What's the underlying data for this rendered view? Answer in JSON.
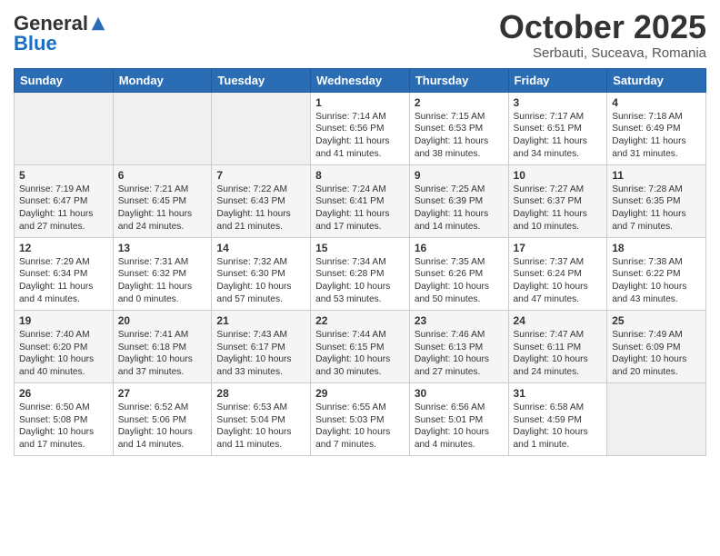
{
  "header": {
    "logo_general": "General",
    "logo_blue": "Blue",
    "month": "October 2025",
    "location": "Serbauti, Suceava, Romania"
  },
  "days_of_week": [
    "Sunday",
    "Monday",
    "Tuesday",
    "Wednesday",
    "Thursday",
    "Friday",
    "Saturday"
  ],
  "weeks": [
    [
      {
        "day": "",
        "content": ""
      },
      {
        "day": "",
        "content": ""
      },
      {
        "day": "",
        "content": ""
      },
      {
        "day": "1",
        "content": "Sunrise: 7:14 AM\nSunset: 6:56 PM\nDaylight: 11 hours and 41 minutes."
      },
      {
        "day": "2",
        "content": "Sunrise: 7:15 AM\nSunset: 6:53 PM\nDaylight: 11 hours and 38 minutes."
      },
      {
        "day": "3",
        "content": "Sunrise: 7:17 AM\nSunset: 6:51 PM\nDaylight: 11 hours and 34 minutes."
      },
      {
        "day": "4",
        "content": "Sunrise: 7:18 AM\nSunset: 6:49 PM\nDaylight: 11 hours and 31 minutes."
      }
    ],
    [
      {
        "day": "5",
        "content": "Sunrise: 7:19 AM\nSunset: 6:47 PM\nDaylight: 11 hours and 27 minutes."
      },
      {
        "day": "6",
        "content": "Sunrise: 7:21 AM\nSunset: 6:45 PM\nDaylight: 11 hours and 24 minutes."
      },
      {
        "day": "7",
        "content": "Sunrise: 7:22 AM\nSunset: 6:43 PM\nDaylight: 11 hours and 21 minutes."
      },
      {
        "day": "8",
        "content": "Sunrise: 7:24 AM\nSunset: 6:41 PM\nDaylight: 11 hours and 17 minutes."
      },
      {
        "day": "9",
        "content": "Sunrise: 7:25 AM\nSunset: 6:39 PM\nDaylight: 11 hours and 14 minutes."
      },
      {
        "day": "10",
        "content": "Sunrise: 7:27 AM\nSunset: 6:37 PM\nDaylight: 11 hours and 10 minutes."
      },
      {
        "day": "11",
        "content": "Sunrise: 7:28 AM\nSunset: 6:35 PM\nDaylight: 11 hours and 7 minutes."
      }
    ],
    [
      {
        "day": "12",
        "content": "Sunrise: 7:29 AM\nSunset: 6:34 PM\nDaylight: 11 hours and 4 minutes."
      },
      {
        "day": "13",
        "content": "Sunrise: 7:31 AM\nSunset: 6:32 PM\nDaylight: 11 hours and 0 minutes."
      },
      {
        "day": "14",
        "content": "Sunrise: 7:32 AM\nSunset: 6:30 PM\nDaylight: 10 hours and 57 minutes."
      },
      {
        "day": "15",
        "content": "Sunrise: 7:34 AM\nSunset: 6:28 PM\nDaylight: 10 hours and 53 minutes."
      },
      {
        "day": "16",
        "content": "Sunrise: 7:35 AM\nSunset: 6:26 PM\nDaylight: 10 hours and 50 minutes."
      },
      {
        "day": "17",
        "content": "Sunrise: 7:37 AM\nSunset: 6:24 PM\nDaylight: 10 hours and 47 minutes."
      },
      {
        "day": "18",
        "content": "Sunrise: 7:38 AM\nSunset: 6:22 PM\nDaylight: 10 hours and 43 minutes."
      }
    ],
    [
      {
        "day": "19",
        "content": "Sunrise: 7:40 AM\nSunset: 6:20 PM\nDaylight: 10 hours and 40 minutes."
      },
      {
        "day": "20",
        "content": "Sunrise: 7:41 AM\nSunset: 6:18 PM\nDaylight: 10 hours and 37 minutes."
      },
      {
        "day": "21",
        "content": "Sunrise: 7:43 AM\nSunset: 6:17 PM\nDaylight: 10 hours and 33 minutes."
      },
      {
        "day": "22",
        "content": "Sunrise: 7:44 AM\nSunset: 6:15 PM\nDaylight: 10 hours and 30 minutes."
      },
      {
        "day": "23",
        "content": "Sunrise: 7:46 AM\nSunset: 6:13 PM\nDaylight: 10 hours and 27 minutes."
      },
      {
        "day": "24",
        "content": "Sunrise: 7:47 AM\nSunset: 6:11 PM\nDaylight: 10 hours and 24 minutes."
      },
      {
        "day": "25",
        "content": "Sunrise: 7:49 AM\nSunset: 6:09 PM\nDaylight: 10 hours and 20 minutes."
      }
    ],
    [
      {
        "day": "26",
        "content": "Sunrise: 6:50 AM\nSunset: 5:08 PM\nDaylight: 10 hours and 17 minutes."
      },
      {
        "day": "27",
        "content": "Sunrise: 6:52 AM\nSunset: 5:06 PM\nDaylight: 10 hours and 14 minutes."
      },
      {
        "day": "28",
        "content": "Sunrise: 6:53 AM\nSunset: 5:04 PM\nDaylight: 10 hours and 11 minutes."
      },
      {
        "day": "29",
        "content": "Sunrise: 6:55 AM\nSunset: 5:03 PM\nDaylight: 10 hours and 7 minutes."
      },
      {
        "day": "30",
        "content": "Sunrise: 6:56 AM\nSunset: 5:01 PM\nDaylight: 10 hours and 4 minutes."
      },
      {
        "day": "31",
        "content": "Sunrise: 6:58 AM\nSunset: 4:59 PM\nDaylight: 10 hours and 1 minute."
      },
      {
        "day": "",
        "content": ""
      }
    ]
  ]
}
